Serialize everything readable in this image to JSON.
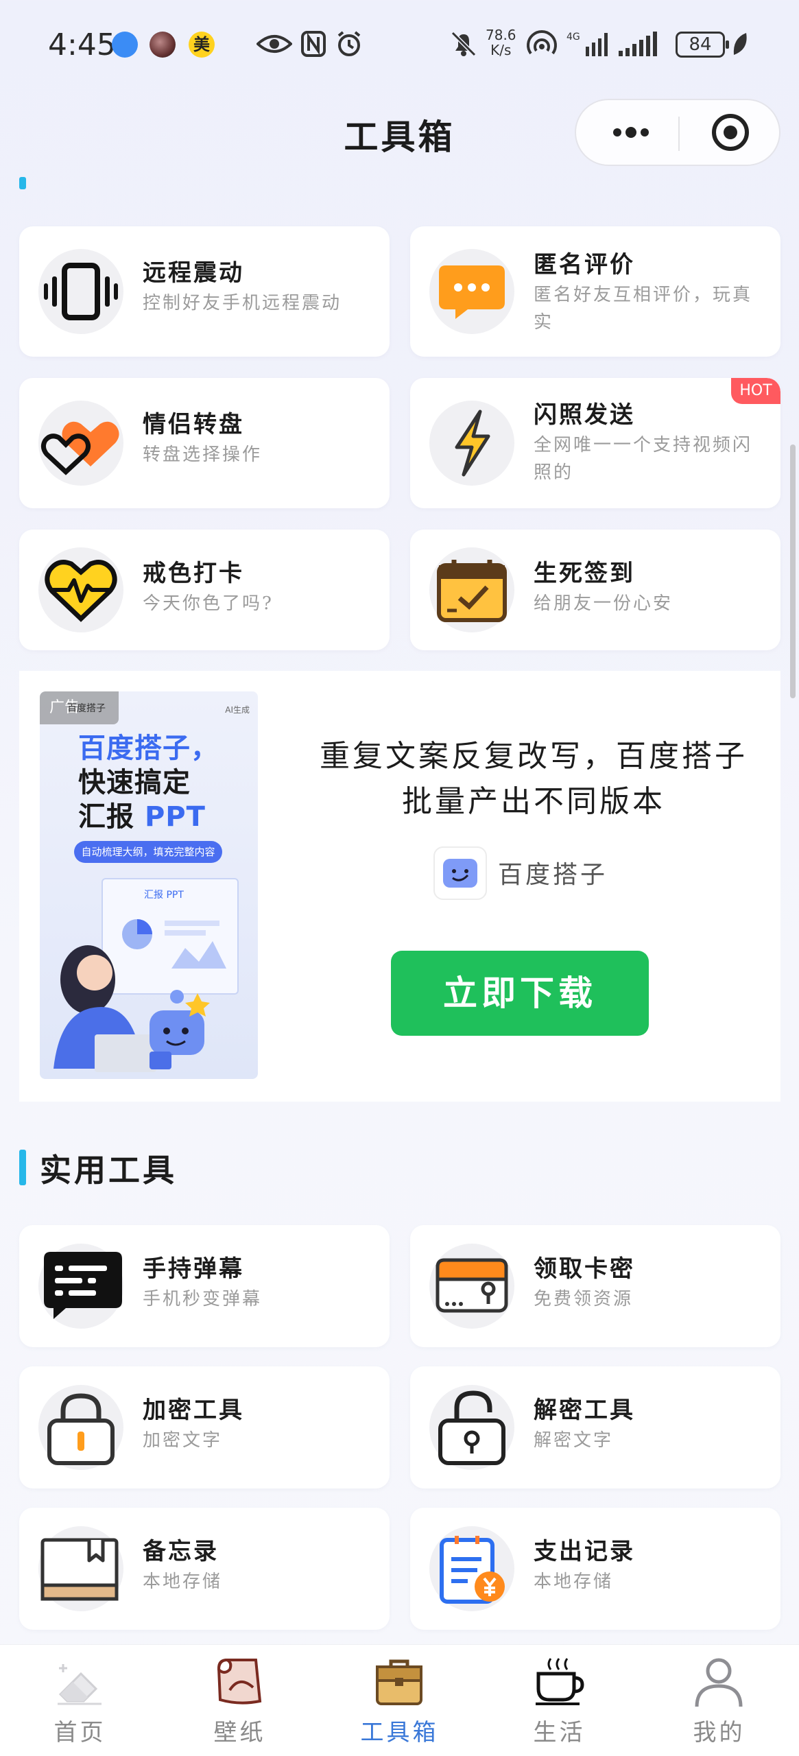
{
  "status_bar": {
    "time": "4:45",
    "notification_badge": "美",
    "net_speed_value": "78.6",
    "net_speed_unit": "K/s",
    "battery": "84"
  },
  "nav": {
    "title": "工具箱"
  },
  "section_top": {
    "cards": [
      {
        "title": "远程震动",
        "desc": "控制好友手机远程震动",
        "icon": "phone-vibrate-icon"
      },
      {
        "title": "匿名评价",
        "desc": "匿名好友互相评价，玩真实",
        "icon": "chat-bubble-icon"
      },
      {
        "title": "情侣转盘",
        "desc": "转盘选择操作",
        "icon": "hearts-icon"
      },
      {
        "title": "闪照发送",
        "desc": "全网唯一一个支持视频闪照的",
        "icon": "lightning-icon",
        "badge": "HOT"
      },
      {
        "title": "戒色打卡",
        "desc": "今天你色了吗?",
        "icon": "heartbeat-icon"
      },
      {
        "title": "生死签到",
        "desc": "给朋友一份心安",
        "icon": "calendar-check-icon"
      }
    ]
  },
  "ad": {
    "tag": "广告",
    "image_brand": "百度搭子",
    "image_ai_label": "AI生成",
    "image_line1": "百度搭子，",
    "image_line2": "快速搞定",
    "image_line3_a": "汇报 ",
    "image_line3_b": "PPT",
    "image_pill": "自动梳理大纲，填充完整内容",
    "image_doc_title": "汇报 PPT",
    "copy": "重复文案反复改写，百度搭子批量产出不同版本",
    "brand": "百度搭子",
    "button": "立即下载"
  },
  "section_tools": {
    "title": "实用工具",
    "cards": [
      {
        "title": "手持弹幕",
        "desc": "手机秒变弹幕",
        "icon": "danmaku-icon"
      },
      {
        "title": "领取卡密",
        "desc": "免费领资源",
        "icon": "card-box-icon"
      },
      {
        "title": "加密工具",
        "desc": "加密文字",
        "icon": "lock-icon"
      },
      {
        "title": "解密工具",
        "desc": "解密文字",
        "icon": "unlock-icon"
      },
      {
        "title": "备忘录",
        "desc": "本地存储",
        "icon": "memo-book-icon"
      },
      {
        "title": "支出记录",
        "desc": "本地存储",
        "icon": "expense-icon"
      }
    ]
  },
  "tabbar": {
    "tabs": [
      {
        "label": "首页",
        "icon": "home-eraser-icon",
        "active": false
      },
      {
        "label": "壁纸",
        "icon": "wallpaper-icon",
        "active": false
      },
      {
        "label": "工具箱",
        "icon": "toolbox-icon",
        "active": true
      },
      {
        "label": "生活",
        "icon": "coffee-cup-icon",
        "active": false
      },
      {
        "label": "我的",
        "icon": "user-icon",
        "active": false
      }
    ]
  },
  "colors": {
    "accent": "#27b7e9",
    "active_tab": "#3a78d8",
    "hot_badge": "#ff5a5f",
    "download_button": "#1fc05b"
  }
}
